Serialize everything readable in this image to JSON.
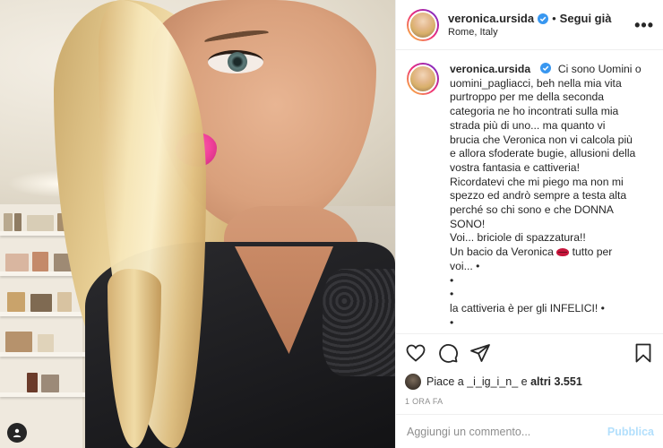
{
  "post": {
    "username": "veronica.ursida",
    "follow_sep": "•",
    "follow_label": "Segui già",
    "location": "Rome, Italy",
    "more_label": "•••"
  },
  "caption": {
    "username": "veronica.ursida",
    "lines": [
      "Ci sono Uomini o",
      "uomini_pagliacci, beh nella mia vita",
      "purtroppo per me della seconda",
      "categoria ne ho incontrati sulla mia",
      "strada più di uno... ma quanto vi",
      "brucia che Veronica non vi calcola più",
      "e allora sfoderate bugie, allusioni della",
      "vostra fantasia e cattiveria!",
      "Ricordatevi che mi piego ma non mi",
      "spezzo ed andrò sempre a testa alta",
      "perché so chi sono e che DONNA",
      "SONO!",
      "Voi... briciole di spazzatura!!"
    ],
    "kiss_line_before": "Un bacio da Veronica",
    "kiss_line_after": "tutto per",
    "line_voi": "voi... •",
    "bullet_1": "•",
    "bullet_2": "•",
    "line_last": "la cattiveria è per gli INFELICI! •",
    "bullet_3": "•"
  },
  "likes": {
    "prefix": "Piace a",
    "liker": "_i_ig_i_n_",
    "connector": "e",
    "others": "altri 3.551"
  },
  "timestamp": "1 ORA FA",
  "comment": {
    "placeholder": "Aggiungi un commento...",
    "publish_label": "Pubblica"
  },
  "icons": {
    "like": "heart-icon",
    "comment": "comment-icon",
    "share": "share-icon",
    "save": "bookmark-icon",
    "verified": "verified-badge-icon",
    "tag": "user-tag-icon"
  },
  "colors": {
    "verified": "#3897f0",
    "publish_disabled": "#b2dffc",
    "text": "#262626",
    "muted": "#8e8e8e"
  }
}
